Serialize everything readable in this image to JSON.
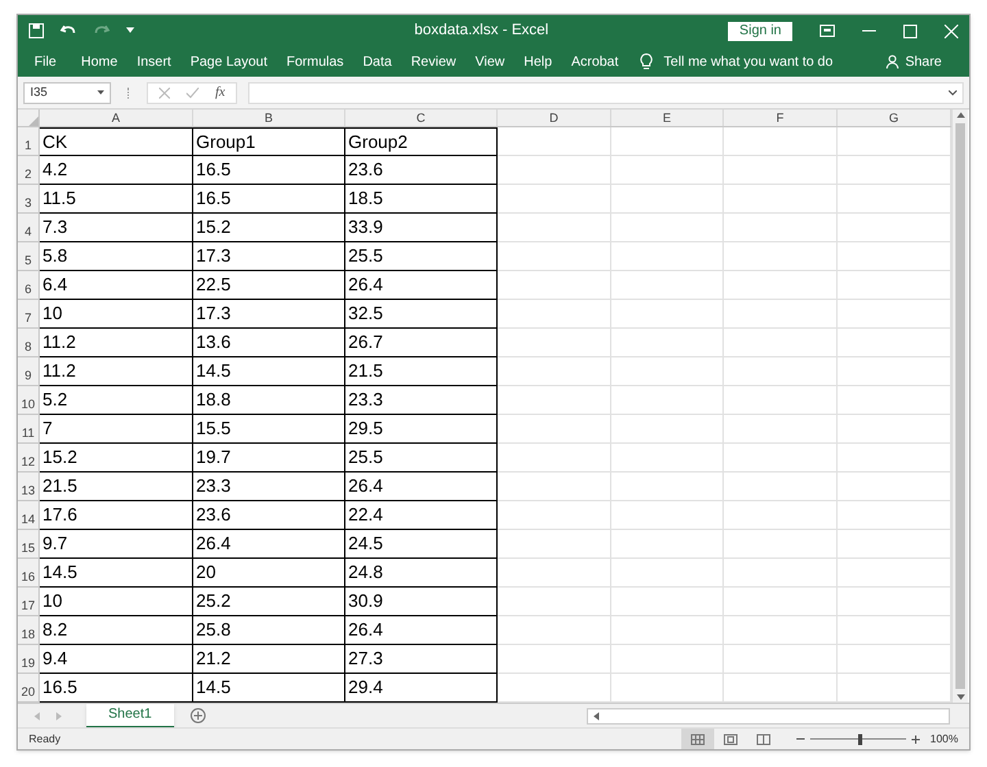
{
  "window": {
    "title": "boxdata.xlsx  -  Excel",
    "sign_in": "Sign in"
  },
  "menu": [
    "File",
    "Home",
    "Insert",
    "Page Layout",
    "Formulas",
    "Data",
    "Review",
    "View",
    "Help",
    "Acrobat"
  ],
  "tell_me": "Tell me what you want to do",
  "share": "Share",
  "formula_bar": {
    "name_box": "I35",
    "fx": "fx"
  },
  "columns": [
    "A",
    "B",
    "C",
    "D",
    "E",
    "F",
    "G"
  ],
  "row_headers": [
    "1",
    "2",
    "3",
    "4",
    "5",
    "6",
    "7",
    "8",
    "9",
    "10",
    "11",
    "12",
    "13",
    "14",
    "15",
    "16",
    "17",
    "18",
    "19",
    "20"
  ],
  "rows": [
    [
      "CK",
      "Group1",
      "Group2"
    ],
    [
      "4.2",
      "16.5",
      "23.6"
    ],
    [
      "11.5",
      "16.5",
      "18.5"
    ],
    [
      "7.3",
      "15.2",
      "33.9"
    ],
    [
      "5.8",
      "17.3",
      "25.5"
    ],
    [
      "6.4",
      "22.5",
      "26.4"
    ],
    [
      "10",
      "17.3",
      "32.5"
    ],
    [
      "11.2",
      "13.6",
      "26.7"
    ],
    [
      "11.2",
      "14.5",
      "21.5"
    ],
    [
      "5.2",
      "18.8",
      "23.3"
    ],
    [
      "7",
      "15.5",
      "29.5"
    ],
    [
      "15.2",
      "19.7",
      "25.5"
    ],
    [
      "21.5",
      "23.3",
      "26.4"
    ],
    [
      "17.6",
      "23.6",
      "22.4"
    ],
    [
      "9.7",
      "26.4",
      "24.5"
    ],
    [
      "14.5",
      "20",
      "24.8"
    ],
    [
      "10",
      "25.2",
      "30.9"
    ],
    [
      "8.2",
      "25.8",
      "26.4"
    ],
    [
      "9.4",
      "21.2",
      "27.3"
    ],
    [
      "16.5",
      "14.5",
      "29.4"
    ]
  ],
  "sheets": [
    {
      "label": "Sheet1",
      "selected": true
    }
  ],
  "status_bar": {
    "text": "Ready",
    "views": [
      {
        "selected": true
      },
      {
        "selected": false
      },
      {
        "selected": false
      }
    ],
    "zoom": {
      "level": 0.5,
      "reading": "100%"
    }
  }
}
